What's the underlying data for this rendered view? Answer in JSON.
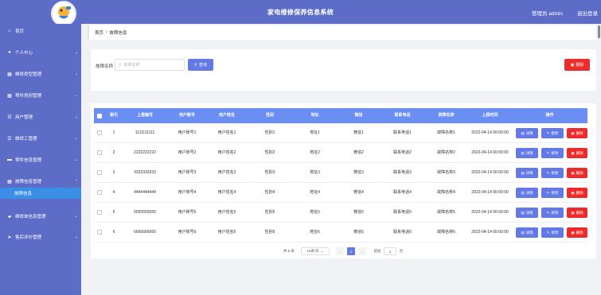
{
  "app": {
    "title": "家电维修保养信息系统",
    "user_label": "管理员 admin",
    "logout_label": "退出登录"
  },
  "sidebar": {
    "items": [
      {
        "icon": "home-icon",
        "glyph": "⌂",
        "label": "首页",
        "has_arrow": false
      },
      {
        "icon": "user-icon",
        "glyph": "●",
        "label": "个人中心",
        "has_arrow": true
      },
      {
        "icon": "grid-icon",
        "glyph": "▦",
        "label": "维修类型管理",
        "has_arrow": true
      },
      {
        "icon": "grid-icon",
        "glyph": "▦",
        "label": "零件类别管理",
        "has_arrow": true
      },
      {
        "icon": "list-icon",
        "glyph": "☰",
        "label": "用户管理",
        "has_arrow": true
      },
      {
        "icon": "list-icon",
        "glyph": "☰",
        "label": "维修工管理",
        "has_arrow": true
      },
      {
        "icon": "card-icon",
        "glyph": "▬",
        "label": "零件信息管理",
        "has_arrow": true
      },
      {
        "icon": "grid-icon",
        "glyph": "▦",
        "label": "故障信息管理",
        "has_arrow": true
      },
      {
        "icon": "truck-icon",
        "glyph": "▰",
        "label": "维修单信息管理",
        "has_arrow": true
      },
      {
        "icon": "send-icon",
        "glyph": "➤",
        "label": "售后评价管理",
        "has_arrow": true
      }
    ],
    "active_sub": "故障信息"
  },
  "breadcrumb": {
    "home": "首页",
    "sep": "/",
    "current": "故障信息"
  },
  "search": {
    "label": "故障名称",
    "placeholder": "故障名称",
    "query_label": "查询",
    "delete_label": "删除"
  },
  "table": {
    "headers": [
      "索引",
      "上报编号",
      "用户账号",
      "用户姓名",
      "性别",
      "地址",
      "微信",
      "联系电话",
      "故障名称",
      "上报时间",
      "操作"
    ],
    "rows": [
      {
        "idx": "1",
        "code": "1111111111",
        "account": "用户账号1",
        "name": "用户姓名1",
        "gender": "性别1",
        "address": "地址1",
        "wechat": "微信1",
        "phone": "联系电话1",
        "fault": "故障名称1",
        "time": "2022-04-14 00:00:00"
      },
      {
        "idx": "2",
        "code": "2222222222",
        "account": "用户账号2",
        "name": "用户姓名2",
        "gender": "性别2",
        "address": "地址2",
        "wechat": "微信2",
        "phone": "联系电话2",
        "fault": "故障名称2",
        "time": "2022-04-14 00:00:00"
      },
      {
        "idx": "3",
        "code": "3333333333",
        "account": "用户账号3",
        "name": "用户姓名3",
        "gender": "性别3",
        "address": "地址3",
        "wechat": "微信3",
        "phone": "联系电话3",
        "fault": "故障名称3",
        "time": "2022-04-14 00:00:00"
      },
      {
        "idx": "4",
        "code": "4444444444",
        "account": "用户账号4",
        "name": "用户姓名4",
        "gender": "性别4",
        "address": "地址4",
        "wechat": "微信4",
        "phone": "联系电话4",
        "fault": "故障名称4",
        "time": "2022-04-14 00:00:00"
      },
      {
        "idx": "5",
        "code": "5555555555",
        "account": "用户账号5",
        "name": "用户姓名5",
        "gender": "性别5",
        "address": "地址5",
        "wechat": "微信5",
        "phone": "联系电话5",
        "fault": "故障名称5",
        "time": "2022-04-14 00:00:00"
      },
      {
        "idx": "6",
        "code": "6666666666",
        "account": "用户账号6",
        "name": "用户姓名6",
        "gender": "性别6",
        "address": "地址6",
        "wechat": "微信6",
        "phone": "联系电话6",
        "fault": "故障名称6",
        "time": "2022-04-14 00:00:00"
      }
    ],
    "actions": {
      "detail": "详情",
      "edit": "修改",
      "delete": "删除"
    }
  },
  "pagination": {
    "total": "共 6 条",
    "page_size": "10条/页",
    "current_page": "1",
    "goto_label": "前往",
    "goto_value": "1",
    "page_unit": "页"
  },
  "colors": {
    "primary": "#5d6cc7",
    "table_header": "#6b8ef4",
    "button": "#6279e6",
    "danger": "#ee2b2b",
    "active_menu": "#3a8ee6"
  }
}
